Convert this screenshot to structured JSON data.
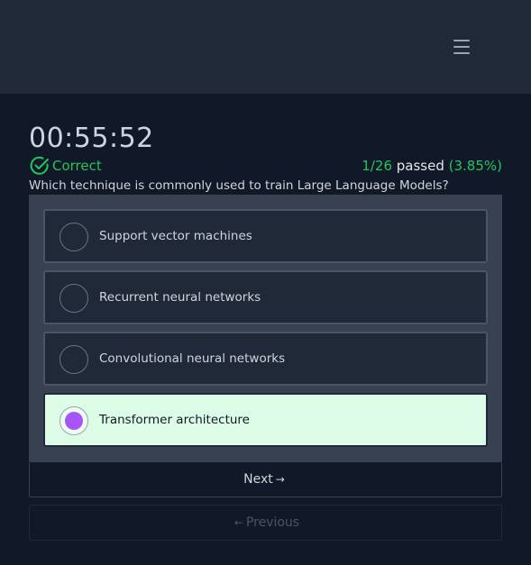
{
  "nav": {
    "menu_icon": "hamburger-menu-icon"
  },
  "quiz": {
    "timer": "00:55:52",
    "result_label": "Correct",
    "result_icon": "check-circle-icon",
    "passed_count": "1/26",
    "passed_word": "passed",
    "passed_percent": "(3.85%)",
    "question": "Which technique is commonly used to train Large Language Models?",
    "options": [
      {
        "label": "Support vector machines",
        "selected": false
      },
      {
        "label": "Recurrent neural networks",
        "selected": false
      },
      {
        "label": "Convolutional neural networks",
        "selected": false
      },
      {
        "label": "Transformer architecture",
        "selected": true
      }
    ],
    "next_label": "Next",
    "next_arrow": "→",
    "prev_label": "Previous",
    "prev_arrow": "←"
  },
  "colors": {
    "background": "#111827",
    "navbar": "#1f2937",
    "success": "#22c55e",
    "selected_bg": "#dcfce7",
    "radio_selected": "#a855f7"
  }
}
